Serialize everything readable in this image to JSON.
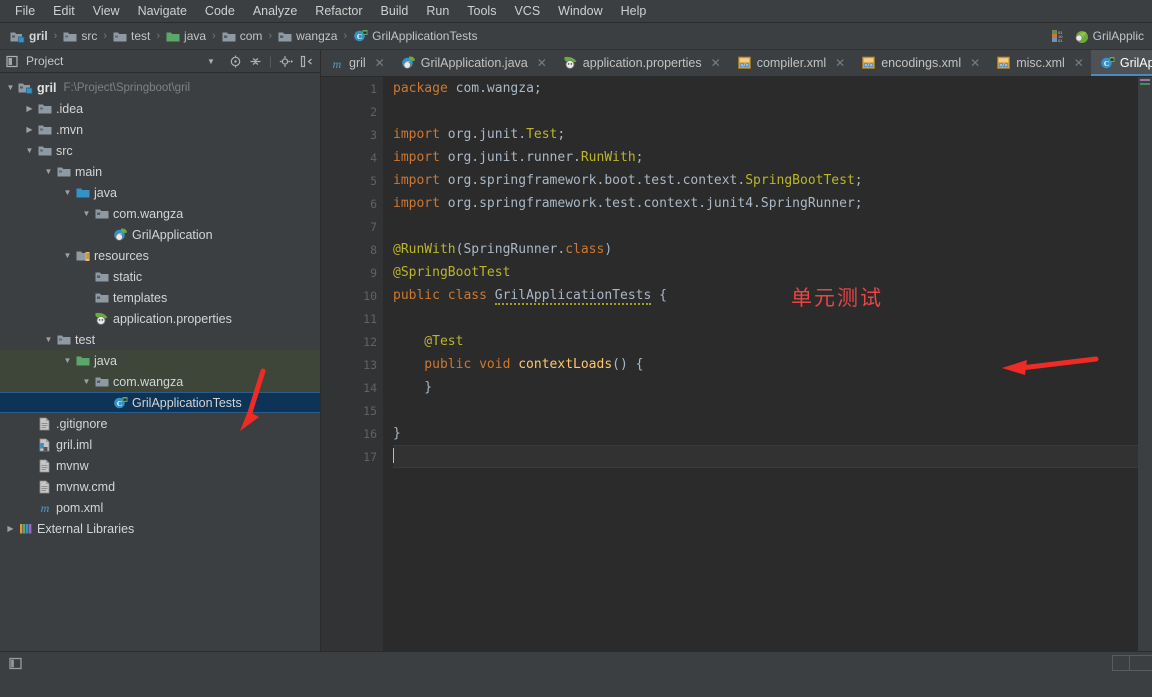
{
  "window": {
    "app": "IntelliJ IDEA",
    "accent": "#4a88c7",
    "annotation_color": "#e84545"
  },
  "menubar": {
    "items": [
      {
        "label": "File"
      },
      {
        "label": "Edit"
      },
      {
        "label": "View"
      },
      {
        "label": "Navigate"
      },
      {
        "label": "Code"
      },
      {
        "label": "Analyze"
      },
      {
        "label": "Refactor"
      },
      {
        "label": "Build"
      },
      {
        "label": "Run"
      },
      {
        "label": "Tools"
      },
      {
        "label": "VCS"
      },
      {
        "label": "Window"
      },
      {
        "label": "Help"
      }
    ]
  },
  "navbar": {
    "crumbs": [
      {
        "label": "gril",
        "icon": "project-module-icon",
        "strong": true
      },
      {
        "label": "src",
        "icon": "folder-icon",
        "strong": false
      },
      {
        "label": "test",
        "icon": "folder-icon",
        "strong": false
      },
      {
        "label": "java",
        "icon": "source-folder-green-icon",
        "strong": false
      },
      {
        "label": "com",
        "icon": "package-icon",
        "strong": false
      },
      {
        "label": "wangza",
        "icon": "package-icon",
        "strong": false
      },
      {
        "label": "GrilApplicationTests",
        "icon": "java-test-class-icon",
        "strong": false
      }
    ],
    "separator": "›",
    "run_config": {
      "label": "GrilApplic",
      "icon": "spring-boot-run-config-icon"
    },
    "vcs_icon": "vcs-updated-icon"
  },
  "sidebar": {
    "tool_title": "Project",
    "tool_icons": [
      {
        "name": "project-view-icon"
      },
      {
        "name": "chevron-down-icon"
      },
      {
        "name": "locate-target-icon"
      },
      {
        "name": "collapse-all-icon"
      },
      {
        "name": "gear-icon"
      },
      {
        "name": "hide-panel-icon"
      }
    ],
    "tree": [
      {
        "label": "gril",
        "sub": "F:\\Project\\Springboot\\gril",
        "indent": 0,
        "arrow": "down",
        "icon": "project-root-icon",
        "bold": true,
        "state": "normal"
      },
      {
        "label": ".idea",
        "sub": "",
        "indent": 1,
        "arrow": "right",
        "icon": "folder-icon",
        "bold": false,
        "state": "normal"
      },
      {
        "label": ".mvn",
        "sub": "",
        "indent": 1,
        "arrow": "right",
        "icon": "folder-icon",
        "bold": false,
        "state": "normal"
      },
      {
        "label": "src",
        "sub": "",
        "indent": 1,
        "arrow": "down",
        "icon": "folder-icon",
        "bold": false,
        "state": "normal"
      },
      {
        "label": "main",
        "sub": "",
        "indent": 2,
        "arrow": "down",
        "icon": "folder-icon",
        "bold": false,
        "state": "normal"
      },
      {
        "label": "java",
        "sub": "",
        "indent": 3,
        "arrow": "down",
        "icon": "source-folder-blue-icon",
        "bold": false,
        "state": "normal"
      },
      {
        "label": "com.wangza",
        "sub": "",
        "indent": 4,
        "arrow": "down",
        "icon": "package-icon",
        "bold": false,
        "state": "normal"
      },
      {
        "label": "GrilApplication",
        "sub": "",
        "indent": 5,
        "arrow": "none",
        "icon": "spring-java-class-icon",
        "bold": false,
        "state": "normal"
      },
      {
        "label": "resources",
        "sub": "",
        "indent": 3,
        "arrow": "down",
        "icon": "resources-folder-icon",
        "bold": false,
        "state": "normal"
      },
      {
        "label": "static",
        "sub": "",
        "indent": 4,
        "arrow": "none",
        "icon": "package-icon",
        "bold": false,
        "state": "normal"
      },
      {
        "label": "templates",
        "sub": "",
        "indent": 4,
        "arrow": "none",
        "icon": "package-icon",
        "bold": false,
        "state": "normal"
      },
      {
        "label": "application.properties",
        "sub": "",
        "indent": 4,
        "arrow": "none",
        "icon": "spring-properties-icon",
        "bold": false,
        "state": "normal"
      },
      {
        "label": "test",
        "sub": "",
        "indent": 2,
        "arrow": "down",
        "icon": "folder-icon",
        "bold": false,
        "state": "normal"
      },
      {
        "label": "java",
        "sub": "",
        "indent": 3,
        "arrow": "down",
        "icon": "test-source-folder-icon",
        "bold": false,
        "state": "testroot"
      },
      {
        "label": "com.wangza",
        "sub": "",
        "indent": 4,
        "arrow": "down",
        "icon": "package-icon",
        "bold": false,
        "state": "testroot"
      },
      {
        "label": "GrilApplicationTests",
        "sub": "",
        "indent": 5,
        "arrow": "none",
        "icon": "java-test-class-icon",
        "bold": false,
        "state": "selected"
      },
      {
        "label": ".gitignore",
        "sub": "",
        "indent": 1,
        "arrow": "none",
        "icon": "file-icon",
        "bold": false,
        "state": "normal"
      },
      {
        "label": "gril.iml",
        "sub": "",
        "indent": 1,
        "arrow": "none",
        "icon": "module-file-icon",
        "bold": false,
        "state": "normal"
      },
      {
        "label": "mvnw",
        "sub": "",
        "indent": 1,
        "arrow": "none",
        "icon": "file-icon",
        "bold": false,
        "state": "normal"
      },
      {
        "label": "mvnw.cmd",
        "sub": "",
        "indent": 1,
        "arrow": "none",
        "icon": "file-icon",
        "bold": false,
        "state": "normal"
      },
      {
        "label": "pom.xml",
        "sub": "",
        "indent": 1,
        "arrow": "none",
        "icon": "maven-icon",
        "bold": false,
        "state": "normal"
      },
      {
        "label": "External Libraries",
        "sub": "",
        "indent": 0,
        "arrow": "right",
        "icon": "external-libraries-icon",
        "bold": false,
        "state": "normal"
      }
    ]
  },
  "editor": {
    "tabs": [
      {
        "label": "gril",
        "icon": "maven-icon",
        "active": false,
        "closable": true
      },
      {
        "label": "GrilApplication.java",
        "icon": "spring-java-class-icon",
        "active": false,
        "closable": true
      },
      {
        "label": "application.properties",
        "icon": "spring-properties-icon",
        "active": false,
        "closable": true
      },
      {
        "label": "compiler.xml",
        "icon": "xml-icon",
        "active": false,
        "closable": true
      },
      {
        "label": "encodings.xml",
        "icon": "xml-icon",
        "active": false,
        "closable": true
      },
      {
        "label": "misc.xml",
        "icon": "xml-icon",
        "active": false,
        "closable": true
      },
      {
        "label": "GrilApp",
        "icon": "java-test-class-icon",
        "active": true,
        "closable": false
      }
    ],
    "file_name": "GrilApplicationTests.java",
    "lines": [
      {
        "n": "1",
        "gutter_icon": "",
        "fold": "",
        "tokens": [
          {
            "t": "package ",
            "c": "kw"
          },
          {
            "t": "com.wangza",
            "c": "cls"
          },
          {
            "t": ";",
            "c": "punct"
          }
        ]
      },
      {
        "n": "2",
        "gutter_icon": "",
        "fold": "",
        "tokens": []
      },
      {
        "n": "3",
        "gutter_icon": "",
        "fold": "open",
        "tokens": [
          {
            "t": "import ",
            "c": "kw"
          },
          {
            "t": "org.junit.",
            "c": "cls"
          },
          {
            "t": "Test",
            "c": "ann"
          },
          {
            "t": ";",
            "c": "punct"
          }
        ]
      },
      {
        "n": "4",
        "gutter_icon": "",
        "fold": "line",
        "tokens": [
          {
            "t": "import ",
            "c": "kw"
          },
          {
            "t": "org.junit.runner.",
            "c": "cls"
          },
          {
            "t": "RunWith",
            "c": "ann"
          },
          {
            "t": ";",
            "c": "punct"
          }
        ]
      },
      {
        "n": "5",
        "gutter_icon": "",
        "fold": "line",
        "tokens": [
          {
            "t": "import ",
            "c": "kw"
          },
          {
            "t": "org.springframework.boot.test.context.",
            "c": "cls"
          },
          {
            "t": "SpringBootTest",
            "c": "ann"
          },
          {
            "t": ";",
            "c": "punct"
          }
        ]
      },
      {
        "n": "6",
        "gutter_icon": "",
        "fold": "close",
        "tokens": [
          {
            "t": "import ",
            "c": "kw"
          },
          {
            "t": "org.springframework.test.context.junit4.",
            "c": "cls"
          },
          {
            "t": "SpringRunner",
            "c": "cls"
          },
          {
            "t": ";",
            "c": "punct"
          }
        ]
      },
      {
        "n": "7",
        "gutter_icon": "",
        "fold": "",
        "tokens": []
      },
      {
        "n": "8",
        "gutter_icon": "",
        "fold": "open",
        "tokens": [
          {
            "t": "@RunWith",
            "c": "ann"
          },
          {
            "t": "(",
            "c": "punct"
          },
          {
            "t": "SpringRunner.",
            "c": "cls"
          },
          {
            "t": "class",
            "c": "kw"
          },
          {
            "t": ")",
            "c": "punct"
          }
        ]
      },
      {
        "n": "9",
        "gutter_icon": "spring-bean-leaf-icon",
        "fold": "close",
        "tokens": [
          {
            "t": "@SpringBootTest",
            "c": "ann"
          }
        ]
      },
      {
        "n": "10",
        "gutter_icon": "run-all-tests-icon",
        "fold": "",
        "tokens": [
          {
            "t": "public ",
            "c": "kw"
          },
          {
            "t": "class ",
            "c": "kw"
          },
          {
            "t": "GrilApplicationTests",
            "c": "warn"
          },
          {
            "t": " {",
            "c": "punct"
          }
        ]
      },
      {
        "n": "11",
        "gutter_icon": "",
        "fold": "",
        "tokens": []
      },
      {
        "n": "12",
        "gutter_icon": "",
        "fold": "",
        "tokens": [
          {
            "t": "    @Test",
            "c": "ann"
          }
        ]
      },
      {
        "n": "13",
        "gutter_icon": "run-test-icon",
        "fold": "",
        "tokens": [
          {
            "t": "    public ",
            "c": "kw"
          },
          {
            "t": "void ",
            "c": "kw"
          },
          {
            "t": "contextLoads",
            "c": "mth"
          },
          {
            "t": "() {",
            "c": "punct"
          }
        ]
      },
      {
        "n": "14",
        "gutter_icon": "",
        "fold": "",
        "tokens": [
          {
            "t": "    }",
            "c": "punct"
          }
        ]
      },
      {
        "n": "15",
        "gutter_icon": "",
        "fold": "",
        "tokens": []
      },
      {
        "n": "16",
        "gutter_icon": "",
        "fold": "",
        "tokens": [
          {
            "t": "}",
            "c": "punct"
          }
        ]
      },
      {
        "n": "17",
        "gutter_icon": "",
        "fold": "",
        "tokens": [],
        "current": true
      }
    ]
  },
  "annotation": {
    "text": "单元测试",
    "arrow_editor": "left-pointing-red-arrow",
    "arrow_tree": "down-left-pointing-red-arrow"
  },
  "statusbar": {
    "left_icon": "toggle-tool-window-bars-icon",
    "text": ""
  }
}
